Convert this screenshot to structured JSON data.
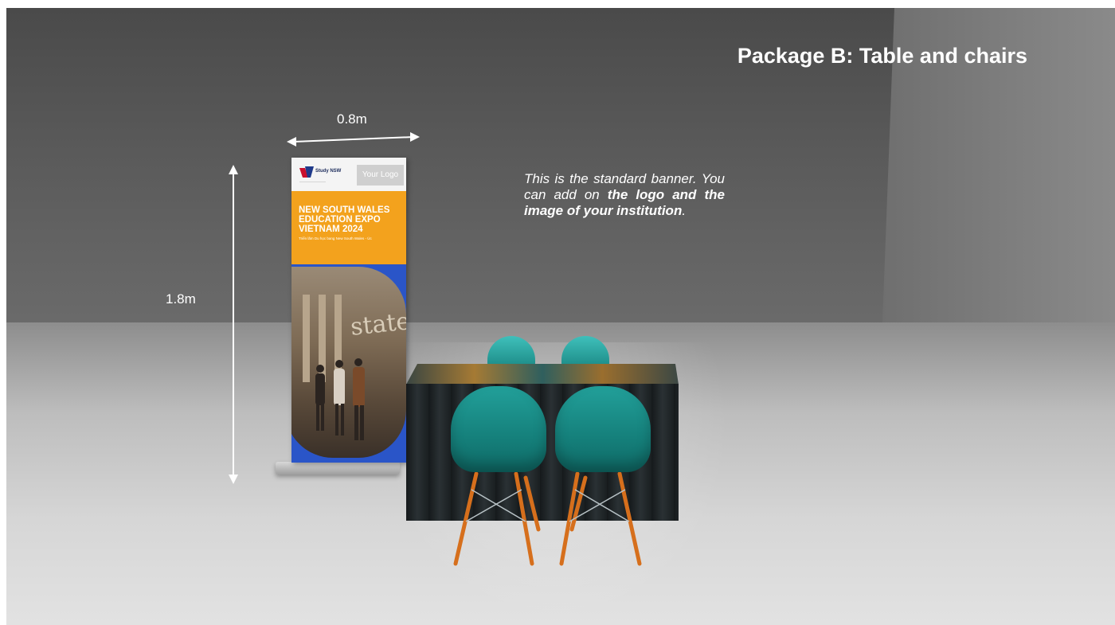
{
  "title": "Package B: Table and chairs",
  "dimensions": {
    "width_label": "0.8m",
    "height_label": "1.8m"
  },
  "description": {
    "part1": "This is the standard banner. You can add on ",
    "bold": "the logo and the image of your institution",
    "part2": "."
  },
  "banner": {
    "brand": "Study NSW",
    "logo_placeholder": "Your Logo",
    "headline_lines": [
      "NEW SOUTH WALES",
      "EDUCATION EXPO",
      "VIETNAM 2024"
    ],
    "subline": "Triển lãm Du học bang New South Wales - Úc",
    "photo_text": "state"
  },
  "colors": {
    "banner_orange": "#f3a21d",
    "banner_blue": "#2a55c8",
    "chair_teal": "#1a9590",
    "leg_orange": "#d66f1c"
  }
}
